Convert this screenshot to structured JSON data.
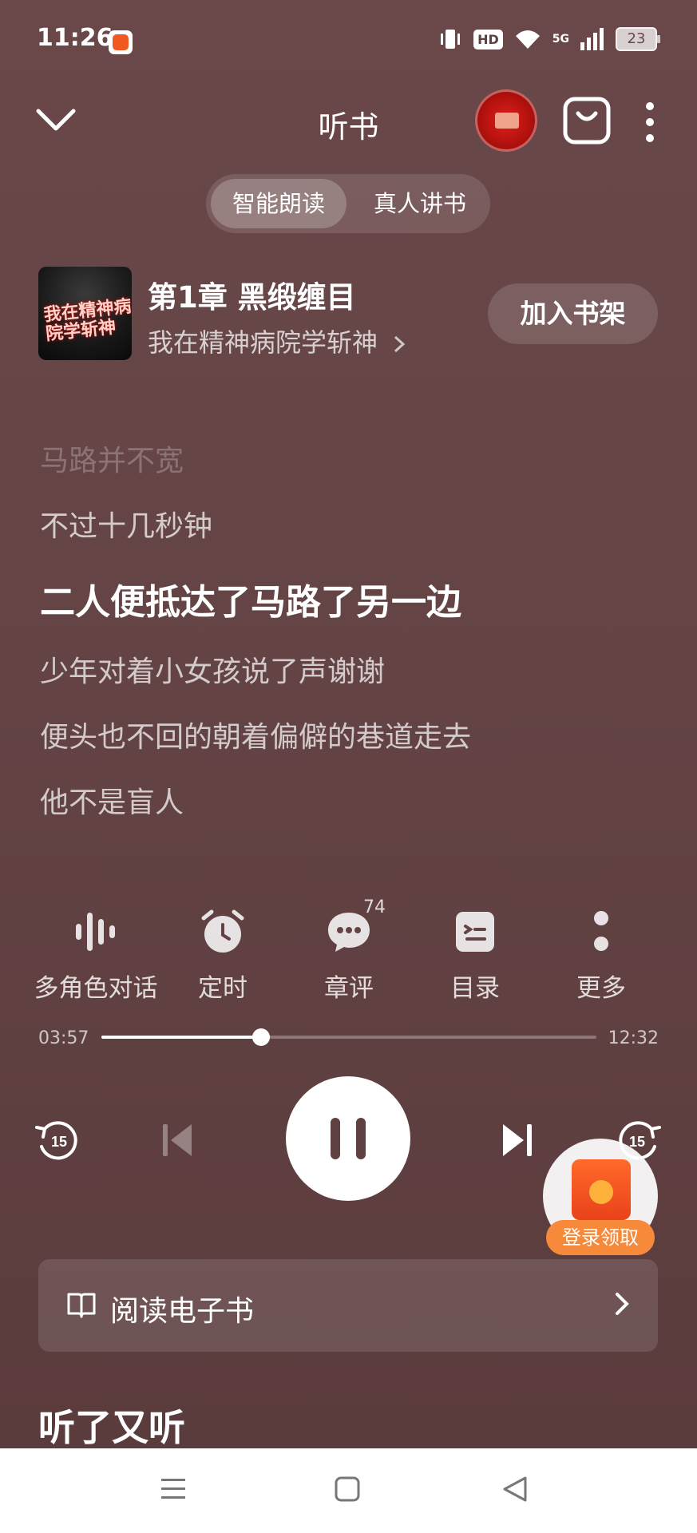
{
  "status_bar": {
    "time": "11:26",
    "hd": "HD",
    "network": "5G",
    "battery": "23"
  },
  "header": {
    "title": "听书"
  },
  "mode_switch": {
    "tabs": [
      {
        "label": "智能朗读",
        "active": true
      },
      {
        "label": "真人讲书",
        "active": false
      }
    ]
  },
  "book": {
    "cover_text": "我在精神病院学斩神",
    "chapter_title": "第1章 黑缎缠目",
    "book_name": "我在精神病院学斩神",
    "add_shelf_label": "加入书架"
  },
  "transcript": {
    "lines": [
      "马路并不宽",
      "不过十几秒钟",
      "二人便抵达了马路了另一边",
      "少年对着小女孩说了声谢谢",
      "便头也不回的朝着偏僻的巷道走去",
      "他不是盲人"
    ],
    "current_index": 2
  },
  "functions": {
    "items": [
      {
        "label": "多角色对话",
        "icon": "voice-wave-icon"
      },
      {
        "label": "定时",
        "icon": "alarm-clock-icon"
      },
      {
        "label": "章评",
        "icon": "comment-bubble-icon",
        "count": "74"
      },
      {
        "label": "目录",
        "icon": "table-of-contents-icon"
      },
      {
        "label": "更多",
        "icon": "more-dots-icon"
      }
    ]
  },
  "player": {
    "current_time": "03:57",
    "total_time": "12:32",
    "progress": 0.322,
    "rewind_seconds": "15",
    "forward_seconds": "15",
    "state": "playing"
  },
  "promo": {
    "label": "登录领取"
  },
  "read_ebook": {
    "label": "阅读电子书"
  },
  "section": {
    "title": "听了又听"
  },
  "colors": {
    "background": "#654546",
    "promo_orange": "#f7893a"
  }
}
